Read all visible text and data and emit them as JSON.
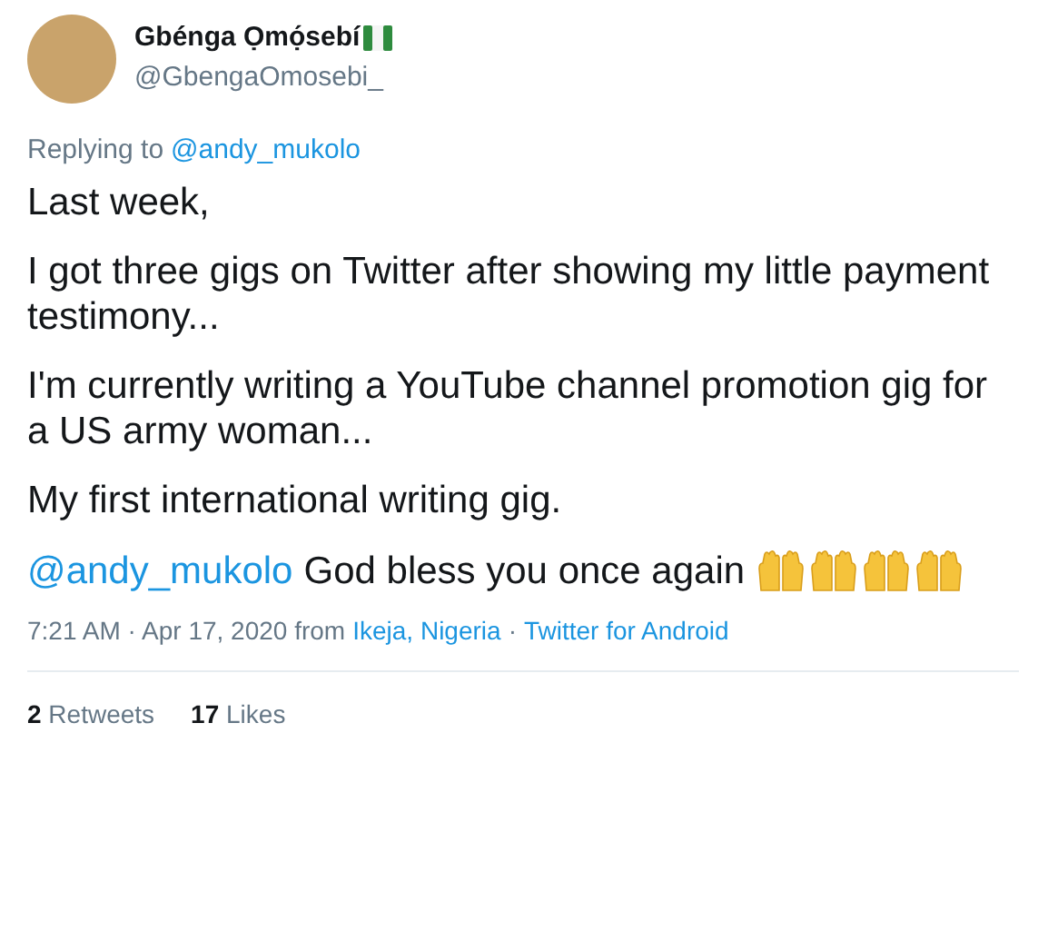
{
  "author": {
    "name": "Gbénga Ọmọ́sebí",
    "handle": "@GbengaOmosebi_"
  },
  "replying_to": {
    "label": "Replying to",
    "mention": "@andy_mukolo"
  },
  "paragraphs": [
    "Last week,",
    "I got three gigs on Twitter after showing my little payment testimony...",
    "I'm currently writing a YouTube channel promotion gig for a US army woman...",
    "My first international writing gig."
  ],
  "closing": {
    "mention": "@andy_mukolo",
    "text": "God bless you once again"
  },
  "meta": {
    "time": "7:21 AM · Apr 17, 2020 from",
    "location": "Ikeja, Nigeria",
    "separator": "·",
    "source": "Twitter for Android"
  },
  "stats": [
    {
      "count": "2",
      "label": "Retweets"
    },
    {
      "count": "17",
      "label": "Likes"
    }
  ]
}
